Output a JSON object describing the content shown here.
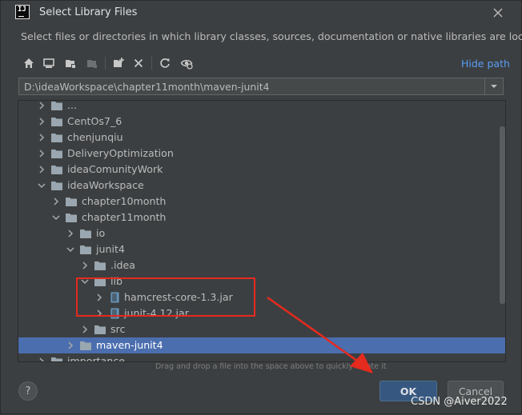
{
  "dialog": {
    "title": "Select Library Files",
    "description": "Select files or directories in which library classes, sources, documentation or native libraries are located"
  },
  "toolbar": {
    "buttons": [
      "home-icon",
      "desktop-icon",
      "project-icon",
      "module-icon",
      "new-folder-icon",
      "delete-icon",
      "refresh-icon",
      "show-hidden-icon"
    ],
    "hide_path": "Hide path"
  },
  "path": {
    "value": "D:\\ideaWorkspace\\chapter11month\\maven-junit4"
  },
  "tree": {
    "rows": [
      {
        "label": "...",
        "depth": 0,
        "type": "folder",
        "expanded": false
      },
      {
        "label": "CentOs7_6",
        "depth": 0,
        "type": "folder",
        "expanded": false
      },
      {
        "label": "chenjunqiu",
        "depth": 0,
        "type": "folder",
        "expanded": false
      },
      {
        "label": "DeliveryOptimization",
        "depth": 0,
        "type": "folder",
        "expanded": false
      },
      {
        "label": "ideaComunityWork",
        "depth": 0,
        "type": "folder",
        "expanded": false
      },
      {
        "label": "ideaWorkspace",
        "depth": 0,
        "type": "folder",
        "expanded": true
      },
      {
        "label": "chapter10month",
        "depth": 1,
        "type": "folder",
        "expanded": false
      },
      {
        "label": "chapter11month",
        "depth": 1,
        "type": "folder",
        "expanded": true
      },
      {
        "label": "io",
        "depth": 2,
        "type": "folder",
        "expanded": false
      },
      {
        "label": "junit4",
        "depth": 2,
        "type": "folder",
        "expanded": true
      },
      {
        "label": ".idea",
        "depth": 3,
        "type": "folder",
        "expanded": false
      },
      {
        "label": "lib",
        "depth": 3,
        "type": "folder",
        "expanded": true
      },
      {
        "label": "hamcrest-core-1.3.jar",
        "depth": 4,
        "type": "jar",
        "expanded": false
      },
      {
        "label": "junit-4.12.jar",
        "depth": 4,
        "type": "jar",
        "expanded": false
      },
      {
        "label": "src",
        "depth": 3,
        "type": "folder",
        "expanded": false
      },
      {
        "label": "maven-junit4",
        "depth": 2,
        "type": "folder",
        "expanded": false,
        "selected": true
      },
      {
        "label": "importance",
        "depth": 0,
        "type": "folder",
        "expanded": false
      }
    ]
  },
  "hint": "Drag and drop a file into the space above to quickly locate it",
  "buttons": {
    "help": "?",
    "ok": "OK",
    "cancel": "Cancel"
  },
  "watermark": "CSDN @Aiver2022",
  "colors": {
    "background": "#3c3f41",
    "selection": "#4b6eaf",
    "link": "#589df6",
    "annotation": "#e52a1e",
    "ok_button": "#365880"
  }
}
